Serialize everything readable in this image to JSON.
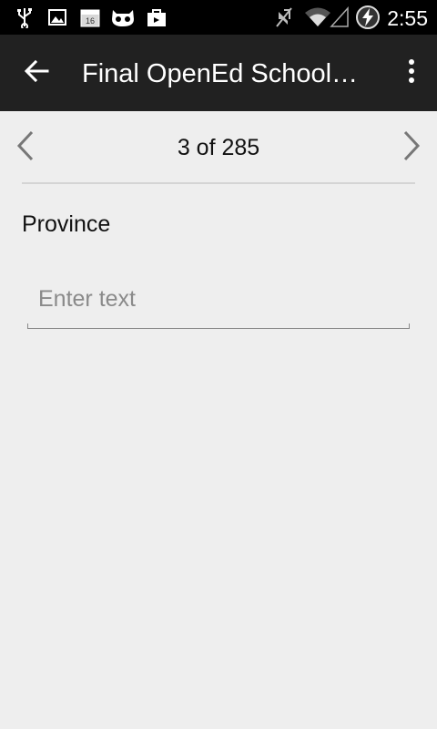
{
  "status_bar": {
    "time": "2:55",
    "icons": [
      "usb-icon",
      "image-icon",
      "calendar-icon",
      "cyanogen-icon",
      "bag-icon",
      "mute-icon",
      "wifi-icon",
      "signal-icon",
      "battery-charging-icon"
    ]
  },
  "app_bar": {
    "title": "Final OpenEd School…",
    "back_icon": "arrow-left-icon",
    "menu_icon": "more-vert-icon"
  },
  "pager": {
    "position": "3 of 285",
    "prev_icon": "chevron-left-icon",
    "next_icon": "chevron-right-icon"
  },
  "form": {
    "field_label": "Province",
    "input_value": "",
    "input_placeholder": "Enter text"
  },
  "colors": {
    "status_bar_bg": "#000000",
    "app_bar_bg": "#212121",
    "page_bg": "#eeeeee",
    "divider": "#d4d4d4",
    "placeholder": "#8a8a8a"
  }
}
